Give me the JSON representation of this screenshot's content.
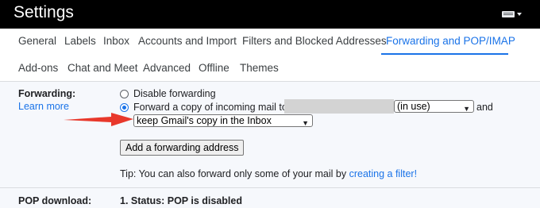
{
  "header": {
    "title": "Settings"
  },
  "tabs": [
    {
      "label": "General",
      "active": false
    },
    {
      "label": "Labels",
      "active": false
    },
    {
      "label": "Inbox",
      "active": false
    },
    {
      "label": "Accounts and Import",
      "active": false
    },
    {
      "label": "Filters and Blocked Addresses",
      "active": false
    },
    {
      "label": "Forwarding and POP/IMAP",
      "active": true
    },
    {
      "label": "Add-ons",
      "active": false
    },
    {
      "label": "Chat and Meet",
      "active": false
    },
    {
      "label": "Advanced",
      "active": false
    },
    {
      "label": "Offline",
      "active": false
    },
    {
      "label": "Themes",
      "active": false
    }
  ],
  "forwarding": {
    "label": "Forwarding:",
    "learn_more": "Learn more",
    "option_disable": "Disable forwarding",
    "option_forward": "Forward a copy of incoming mail to",
    "address_status": "(in use)",
    "and_text": "and",
    "action_select": "keep Gmail's copy in the Inbox",
    "add_button": "Add a forwarding address",
    "tip_prefix": "Tip: You can also forward only some of your mail by",
    "tip_link": "creating a filter!"
  },
  "pop": {
    "label": "POP download:",
    "status": "1. Status: POP is disabled"
  },
  "colors": {
    "accent": "#1a73e8",
    "annotation_arrow": "#e8382b"
  }
}
